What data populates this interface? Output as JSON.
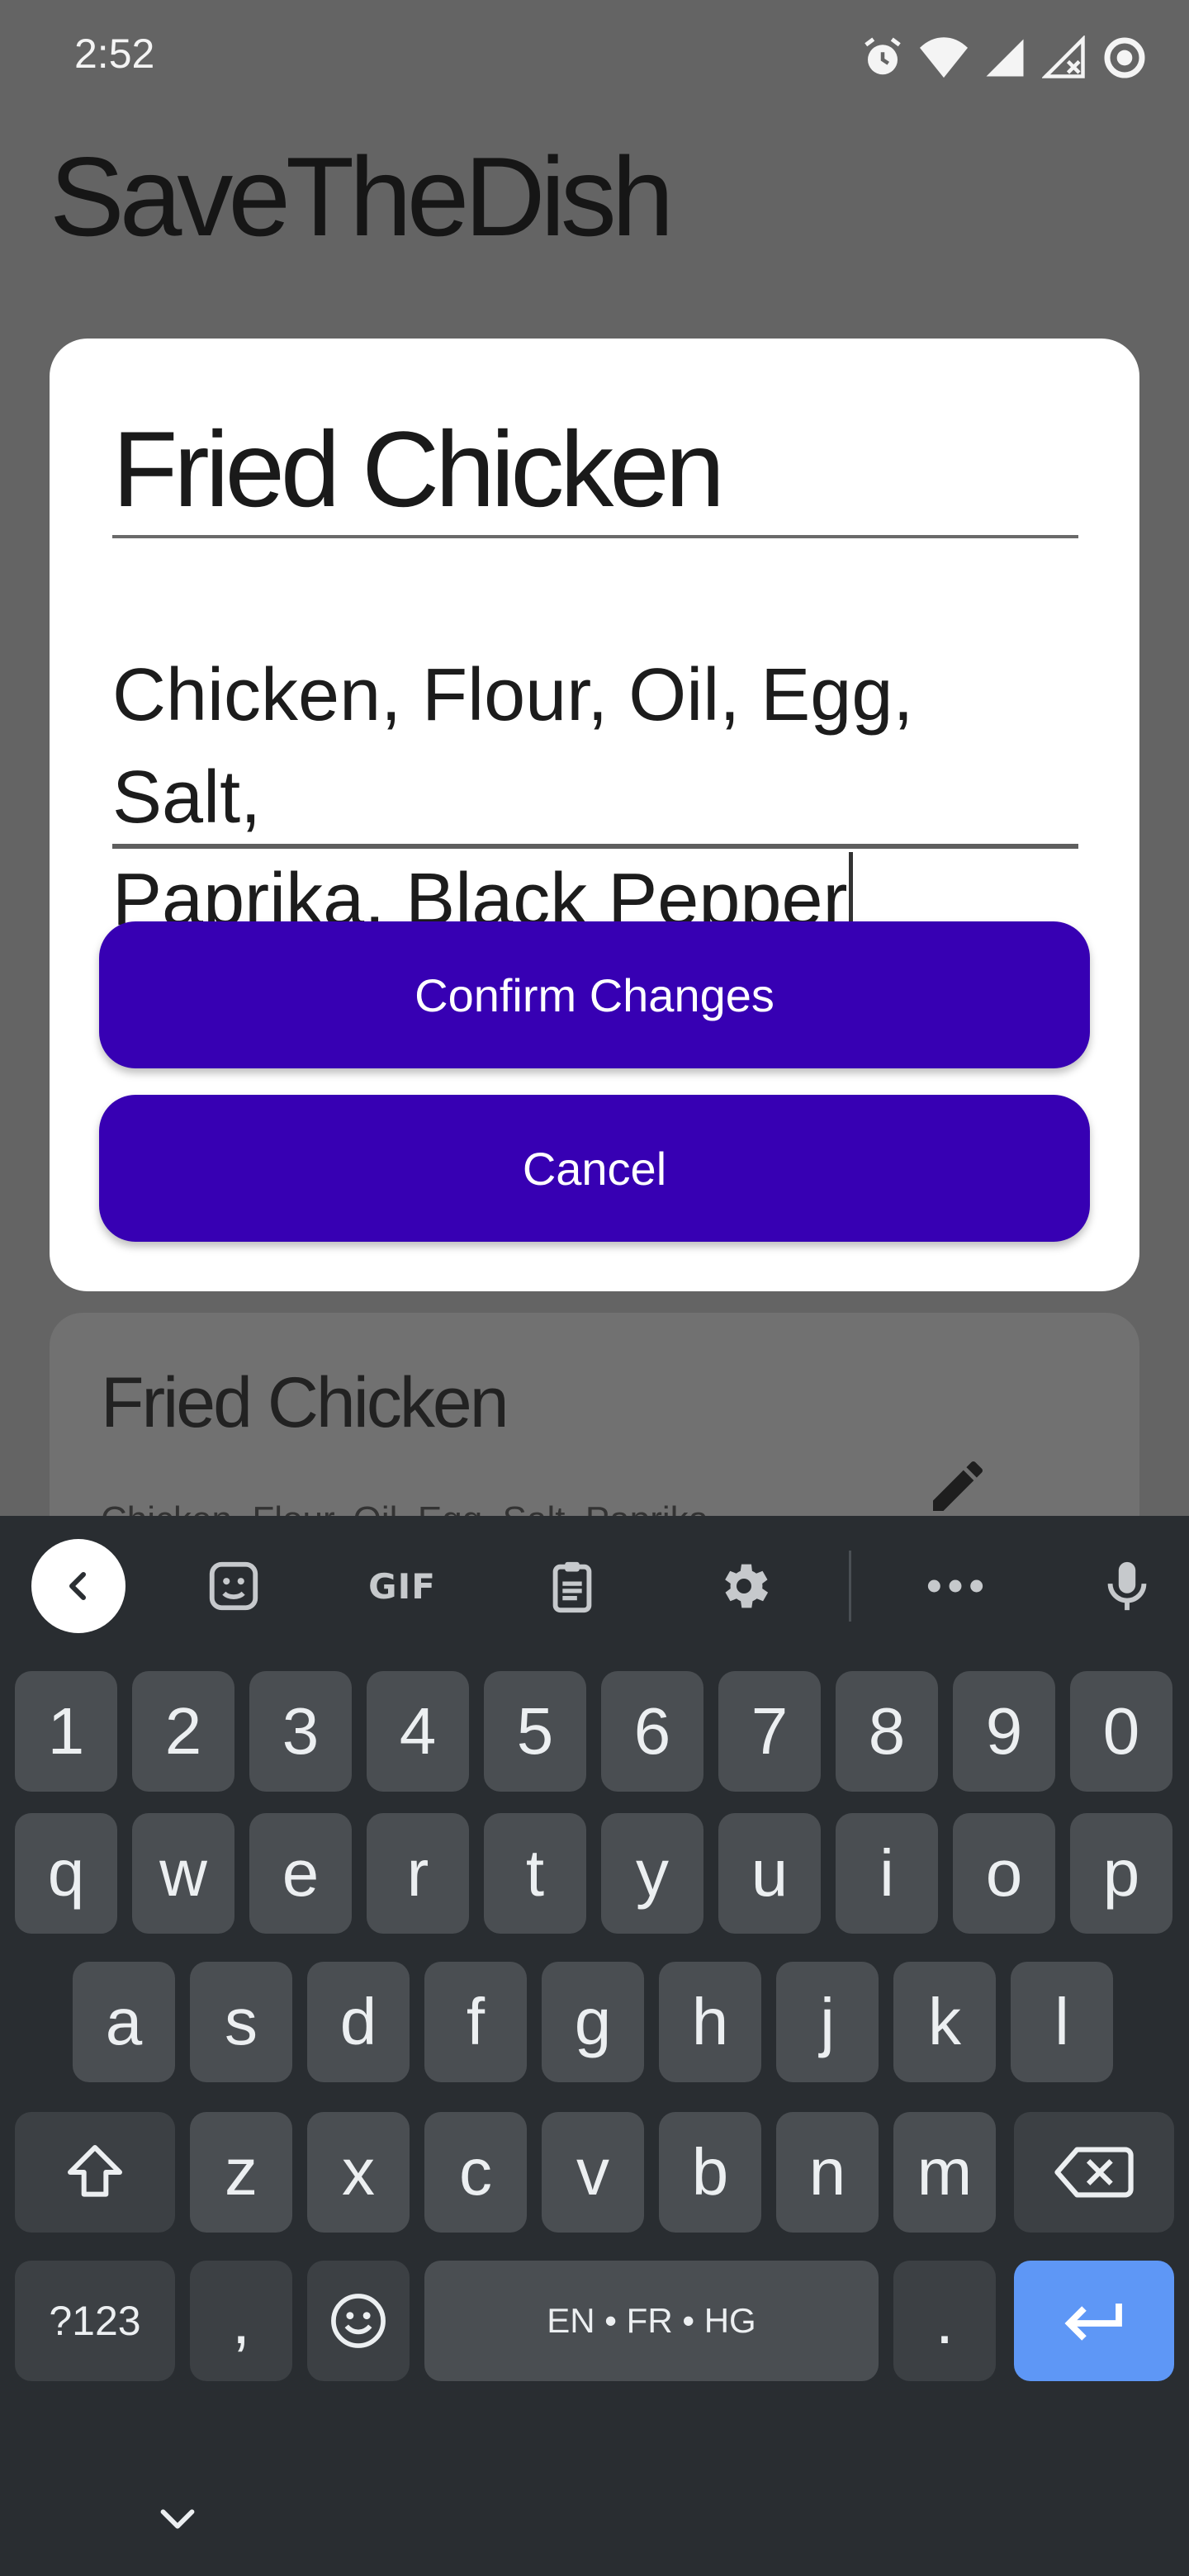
{
  "status_bar": {
    "time": "2:52",
    "icons": [
      "alarm-icon",
      "wifi-icon",
      "signal-icon",
      "signal-no-service-icon",
      "data-saver-icon"
    ]
  },
  "app": {
    "title": "SaveTheDish"
  },
  "background_card": {
    "title": "Fried Chicken",
    "ingredients_preview": "Chicken, Flour, Oil, Egg, Salt, Paprika..."
  },
  "dialog": {
    "title_value": "Fried Chicken",
    "ingredients_line1": "Chicken, Flour, Oil, Egg, Salt,",
    "ingredients_line2_prefix": "Paprika, Black ",
    "ingredients_composing_word": "Pepper",
    "confirm_label": "Confirm Changes",
    "cancel_label": "Cancel"
  },
  "keyboard": {
    "toolbar": {
      "gif_label": "GIF",
      "icons": [
        "back-icon",
        "sticker-icon",
        "gif-icon",
        "clipboard-icon",
        "gear-icon",
        "more-icon",
        "microphone-icon"
      ]
    },
    "row_numbers": [
      "1",
      "2",
      "3",
      "4",
      "5",
      "6",
      "7",
      "8",
      "9",
      "0"
    ],
    "row_1": [
      "q",
      "w",
      "e",
      "r",
      "t",
      "y",
      "u",
      "i",
      "o",
      "p"
    ],
    "row_2": [
      "a",
      "s",
      "d",
      "f",
      "g",
      "h",
      "j",
      "k",
      "l"
    ],
    "row_3": [
      "z",
      "x",
      "c",
      "v",
      "b",
      "n",
      "m"
    ],
    "symbols_label": "?123",
    "comma_label": ",",
    "space_label": "EN • FR • HG",
    "period_label": ".",
    "accent_color": "#5e97f6"
  },
  "colors": {
    "primary_button": "#3700b3",
    "keyboard_bg": "#292d31",
    "key_bg": "#4a4e52"
  }
}
